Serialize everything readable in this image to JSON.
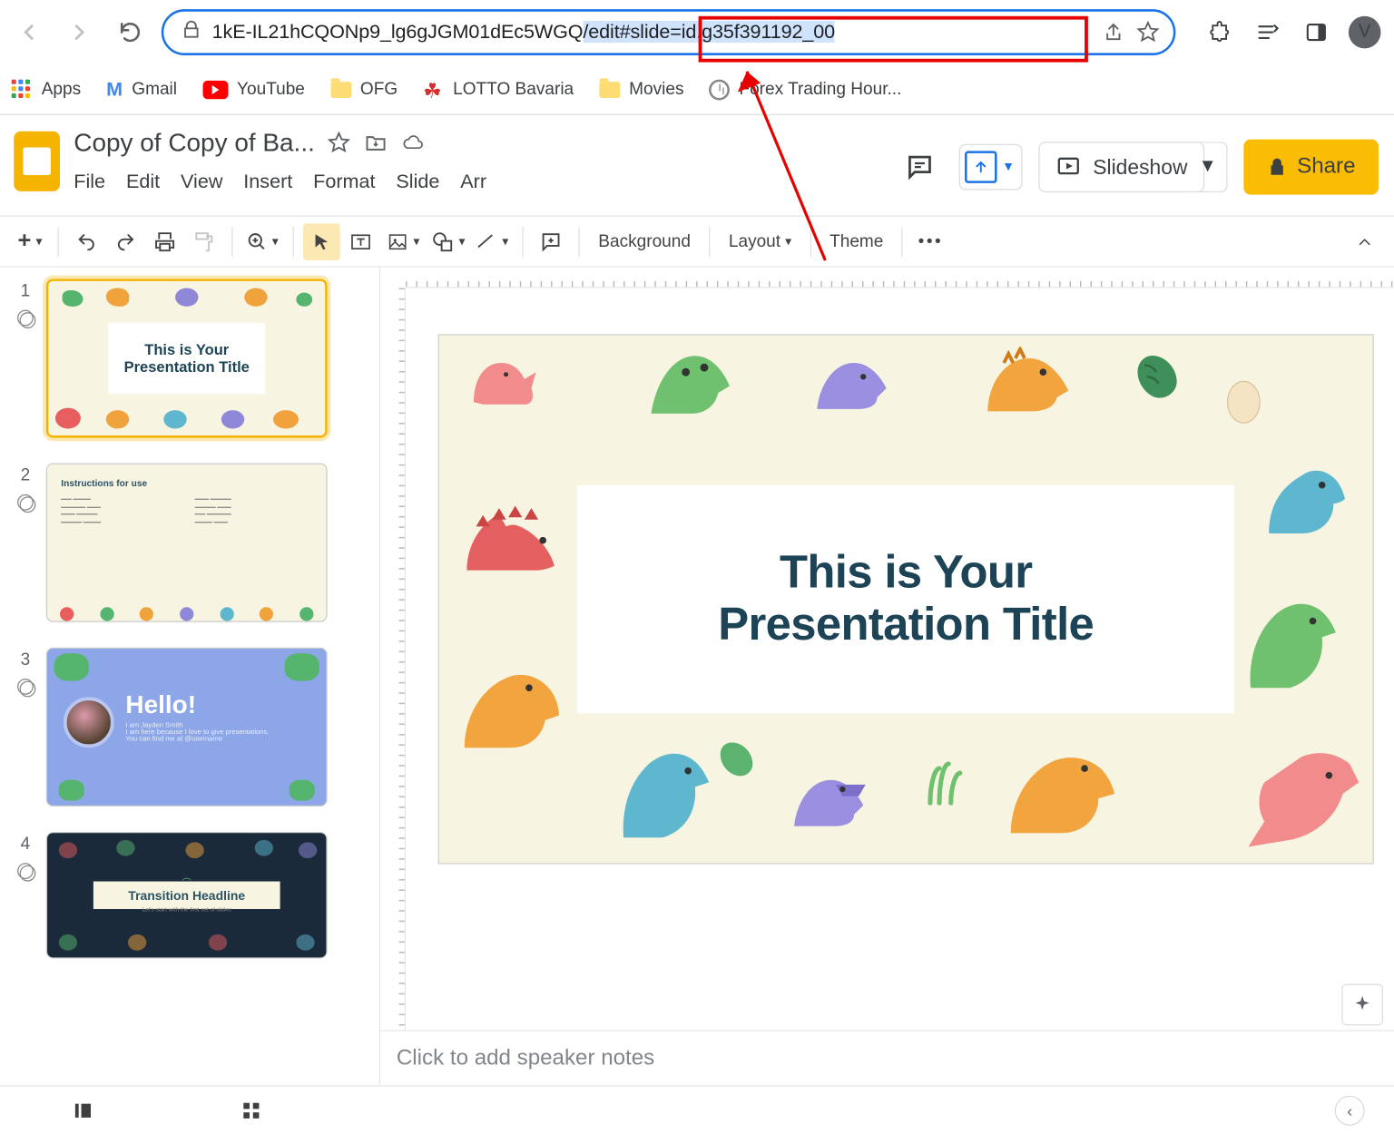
{
  "browser": {
    "url_plain": "1kE-IL21hCQONp9_lg6gJGM01dEc5WGQ",
    "url_selected": "/edit#slide=id.g35f391192_00"
  },
  "bookmarks": {
    "apps": "Apps",
    "gmail": "Gmail",
    "youtube": "YouTube",
    "ofg": "OFG",
    "lotto": "LOTTO Bavaria",
    "movies": "Movies",
    "forex": "Forex Trading Hour..."
  },
  "doc": {
    "title": "Copy of Copy of Ba...",
    "menus": [
      "File",
      "Edit",
      "View",
      "Insert",
      "Format",
      "Slide",
      "Arr"
    ]
  },
  "header_buttons": {
    "slideshow": "Slideshow",
    "share": "Share"
  },
  "toolbar": {
    "background": "Background",
    "layout": "Layout",
    "theme": "Theme"
  },
  "slide": {
    "line1": "This is Your",
    "line2": "Presentation Title"
  },
  "thumbs": {
    "t1": {
      "num": "1",
      "line1": "This is Your",
      "line2": "Presentation Title"
    },
    "t2": {
      "num": "2",
      "heading": "Instructions for use"
    },
    "t3": {
      "num": "3",
      "hello": "Hello!",
      "name": "I am Jayden Smith",
      "sub1": "I am here because I love to give presentations.",
      "sub2": "You can find me at @username"
    },
    "t4": {
      "num": "4",
      "headline": "Transition Headline",
      "sub": "Let's start with the first set of slides"
    }
  },
  "notes": {
    "placeholder": "Click to add speaker notes"
  }
}
